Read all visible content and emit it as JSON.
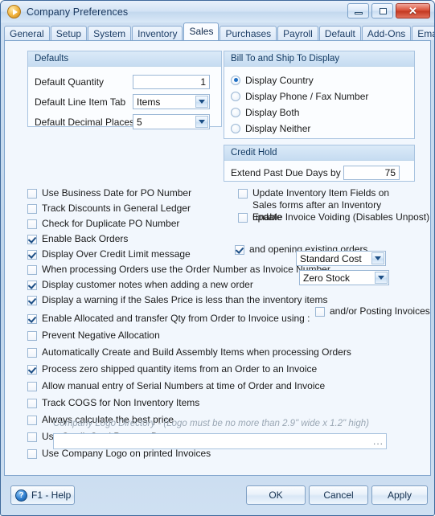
{
  "window": {
    "title": "Company Preferences",
    "icon": "play-circle-icon",
    "controls": {
      "minimize": "minimize-icon",
      "maximize": "maximize-icon",
      "close": "✕"
    }
  },
  "tabs": [
    {
      "label": "General",
      "active": false
    },
    {
      "label": "Setup",
      "active": false
    },
    {
      "label": "System",
      "active": false
    },
    {
      "label": "Inventory",
      "active": false
    },
    {
      "label": "Sales",
      "active": true
    },
    {
      "label": "Purchases",
      "active": false
    },
    {
      "label": "Payroll",
      "active": false
    },
    {
      "label": "Default",
      "active": false
    },
    {
      "label": "Add-Ons",
      "active": false
    },
    {
      "label": "Email Setup",
      "active": false
    }
  ],
  "defaults_group": {
    "title": "Defaults",
    "quantity_label": "Default Quantity",
    "quantity_value": "1",
    "line_item_tab_label": "Default Line Item Tab",
    "line_item_tab_value": "Items",
    "decimal_places_label": "Default Decimal Places",
    "decimal_places_value": "5"
  },
  "bill_ship_group": {
    "title": "Bill To and Ship To Display",
    "options": [
      {
        "label": "Display Country",
        "selected": true
      },
      {
        "label": "Display Phone / Fax Number",
        "selected": false
      },
      {
        "label": "Display Both",
        "selected": false
      },
      {
        "label": "Display Neither",
        "selected": false
      }
    ]
  },
  "credit_hold_group": {
    "title": "Credit Hold",
    "extend_label": "Extend Past Due Days by",
    "extend_value": "75"
  },
  "right_checkboxes": [
    {
      "label": "Update Inventory Item Fields on Sales forms after an Inventory update",
      "checked": false
    },
    {
      "label": "Enable Invoice Voiding (Disables Unpost)",
      "checked": false
    }
  ],
  "main_checkboxes": [
    {
      "label": "Use Business Date for PO Number",
      "checked": false
    },
    {
      "label": "Track Discounts in General Ledger",
      "checked": false
    },
    {
      "label": "Check for Duplicate PO Number",
      "checked": false
    },
    {
      "label": "Enable Back Orders",
      "checked": true
    },
    {
      "label": "Display Over Credit Limit message",
      "checked": true
    },
    {
      "label": "When processing Orders use the Order Number as Invoice Number",
      "checked": false
    },
    {
      "label": "Display customer notes when adding a new order",
      "checked": true
    },
    {
      "label": "Display a warning if the Sales Price is less than the inventory items",
      "checked": true
    },
    {
      "label": "Enable Allocated and transfer Qty from Order to Invoice using :",
      "checked": true
    },
    {
      "label": "Prevent Negative Allocation",
      "checked": false
    },
    {
      "label": "Automatically Create and Build Assembly Items when processing Orders",
      "checked": false
    },
    {
      "label": "Process zero shipped quantity items from an Order to an Invoice",
      "checked": true
    },
    {
      "label": "Allow manual entry of Serial Numbers at time of Order and Invoice",
      "checked": false
    },
    {
      "label": "Track COGS for Non Inventory Items",
      "checked": false
    },
    {
      "label": "Always calculate the best price",
      "checked": false
    },
    {
      "label": "Use Credit Card Process Date",
      "checked": false
    },
    {
      "label": "Use Company Logo on printed Invoices",
      "checked": false
    }
  ],
  "inline_checkboxes": {
    "opening_existing_orders": {
      "label": "and opening existing orders.",
      "checked": true
    },
    "posting_invoices": {
      "label": "and/or Posting Invoices",
      "checked": false
    }
  },
  "dropdowns": {
    "sales_price_basis": "Standard Cost",
    "allocated_transfer_basis": "Zero Stock"
  },
  "logo_directory": {
    "note": "Company Logo Directory - (Logo must be no more than 2.9\" wide x 1.2\" high)",
    "value": "",
    "browse_label": "..."
  },
  "footer": {
    "help_label": "F1 - Help",
    "help_icon_glyph": "?",
    "ok_label": "OK",
    "cancel_label": "Cancel",
    "apply_label": "Apply"
  }
}
